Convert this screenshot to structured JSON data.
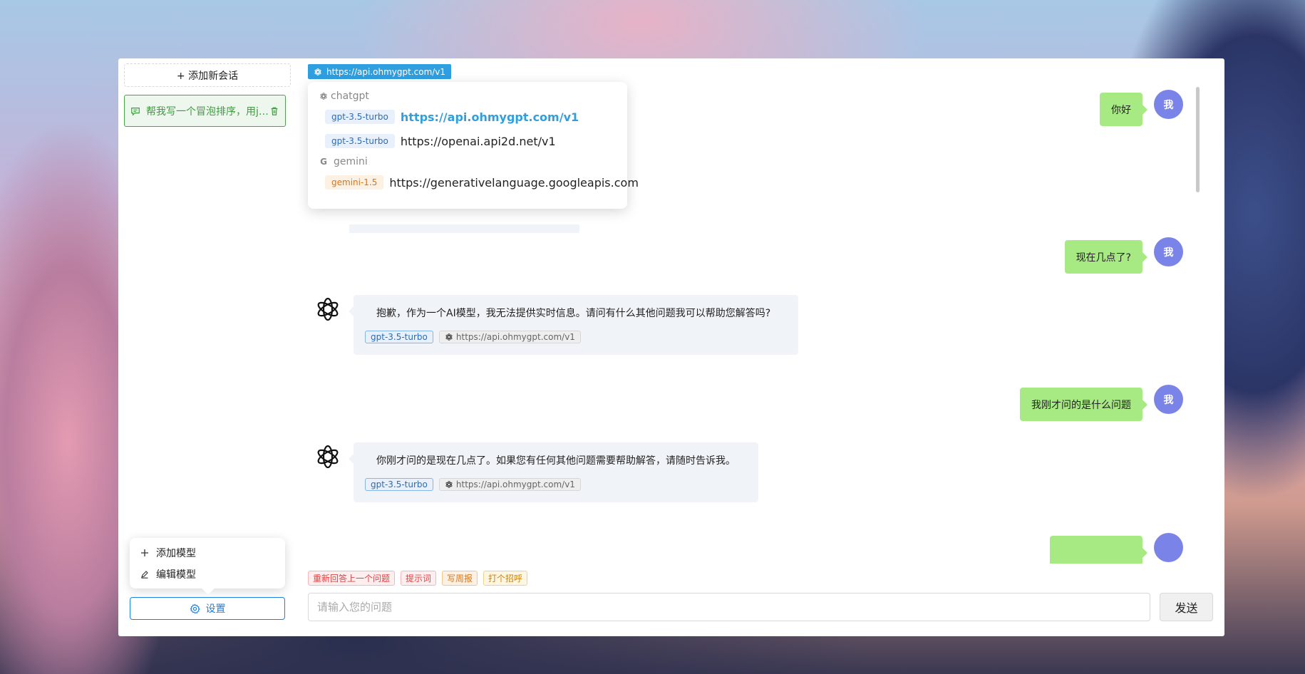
{
  "sidebar": {
    "new_chat_label": "+ 添加新会话",
    "conversations": [
      {
        "title": "帮我写一个冒泡排序，用java实现"
      }
    ],
    "menu": {
      "add_model": "添加模型",
      "edit_model": "编辑模型"
    },
    "settings_label": "设置"
  },
  "endpoint": {
    "current": "https://api.ohmygpt.com/v1",
    "groups": [
      {
        "name": "chatgpt",
        "options": [
          {
            "model": "gpt-3.5-turbo",
            "url": "https://api.ohmygpt.com/v1",
            "selected": true
          },
          {
            "model": "gpt-3.5-turbo",
            "url": "https://openai.api2d.net/v1",
            "selected": false
          }
        ]
      },
      {
        "name": "gemini",
        "options": [
          {
            "model": "gemini-1.5",
            "url": "https://generativelanguage.googleapis.com",
            "selected": false
          }
        ]
      }
    ]
  },
  "messages": [
    {
      "role": "user",
      "avatar": "我",
      "text": "你好"
    },
    {
      "role": "user",
      "avatar": "我",
      "text": "现在几点了?"
    },
    {
      "role": "assistant",
      "text": "抱歉，作为一个AI模型，我无法提供实时信息。请问有什么其他问题我可以帮助您解答吗?",
      "model": "gpt-3.5-turbo",
      "endpoint": "https://api.ohmygpt.com/v1"
    },
    {
      "role": "user",
      "avatar": "我",
      "text": "我刚才问的是什么问题"
    },
    {
      "role": "assistant",
      "text": "你刚才问的是现在几点了。如果您有任何其他问题需要帮助解答，请随时告诉我。",
      "model": "gpt-3.5-turbo",
      "endpoint": "https://api.ohmygpt.com/v1"
    }
  ],
  "quick_actions": [
    "重新回答上一个问题",
    "提示词",
    "写周报",
    "打个招呼"
  ],
  "composer": {
    "placeholder": "请输入您的问题",
    "send_label": "发送"
  },
  "colors": {
    "accent": "#2f9fe0",
    "user_bubble": "#a7ea84",
    "user_avatar": "#7a83e8",
    "assistant_bubble": "#f0f3f7",
    "active_conversation": "#4ba24b"
  },
  "icons": {
    "openai": "openai-logo-icon",
    "google": "google-g-icon",
    "chat": "chat-bubble-icon",
    "trash": "trash-icon",
    "plus": "plus-icon",
    "edit": "pencil-icon",
    "settings": "gear-icon"
  }
}
